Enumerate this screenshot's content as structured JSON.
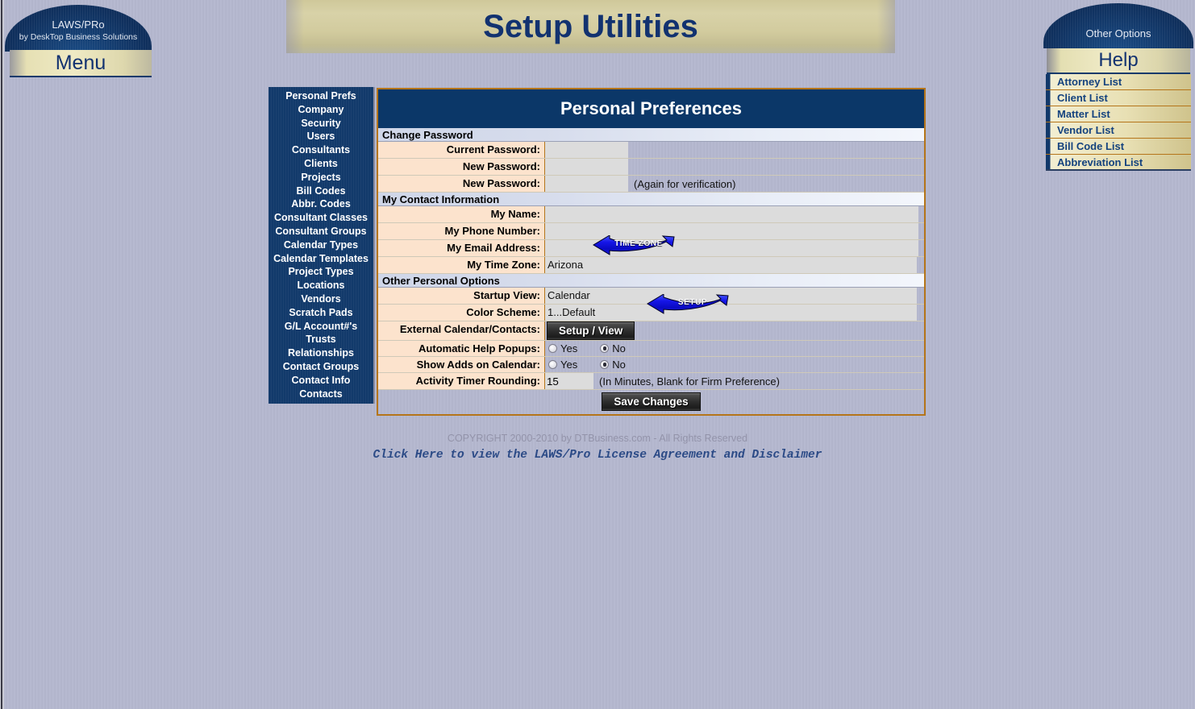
{
  "page": {
    "title": "Setup Utilities"
  },
  "logo": {
    "name": "LAWS/PRo",
    "subtitle": "by DeskTop Business Solutions",
    "menu_label": "Menu"
  },
  "options_panel": {
    "header": "Other Options",
    "help_label": "Help",
    "items": [
      {
        "label": "Attorney List"
      },
      {
        "label": "Client List"
      },
      {
        "label": "Matter List"
      },
      {
        "label": "Vendor List"
      },
      {
        "label": "Bill Code List"
      },
      {
        "label": "Abbreviation List"
      }
    ]
  },
  "setup_menu": {
    "items": [
      {
        "label": "Personal Prefs"
      },
      {
        "label": "Company"
      },
      {
        "label": "Security"
      },
      {
        "label": "Users"
      },
      {
        "label": "Consultants"
      },
      {
        "label": "Clients"
      },
      {
        "label": "Projects"
      },
      {
        "label": "Bill Codes"
      },
      {
        "label": "Abbr. Codes"
      },
      {
        "label": "Consultant Classes"
      },
      {
        "label": "Consultant Groups"
      },
      {
        "label": "Calendar Types"
      },
      {
        "label": "Calendar Templates"
      },
      {
        "label": "Project Types"
      },
      {
        "label": "Locations"
      },
      {
        "label": "Vendors"
      },
      {
        "label": "Scratch Pads"
      },
      {
        "label": "G/L Account#'s"
      },
      {
        "label": "Trusts"
      },
      {
        "label": "Relationships"
      },
      {
        "label": "Contact Groups"
      },
      {
        "label": "Contact Info"
      },
      {
        "label": "Contacts"
      }
    ]
  },
  "form": {
    "header": "Personal Preferences",
    "sections": {
      "change_password": {
        "title": "Change Password",
        "current_password_label": "Current Password:",
        "current_password_value": "",
        "new_password_label": "New Password:",
        "new_password_value": "",
        "new_password_verify_label": "New Password:",
        "new_password_verify_value": "",
        "verify_note": "(Again for verification)"
      },
      "contact_information": {
        "title": "My Contact Information",
        "name_label": "My Name:",
        "name_value": "",
        "phone_label": "My Phone Number:",
        "phone_value": "",
        "email_label": "My Email Address:",
        "email_value": "",
        "timezone_label": "My Time Zone:",
        "timezone_value": "Arizona"
      },
      "other_options": {
        "title": "Other Personal Options",
        "startup_view_label": "Startup View:",
        "startup_view_value": "Calendar",
        "color_scheme_label": "Color Scheme:",
        "color_scheme_value": "1...Default",
        "external_calendar_label": "External Calendar/Contacts:",
        "external_calendar_button": "Setup / View",
        "help_popups_label": "Automatic Help Popups:",
        "help_popups_yes": "Yes",
        "help_popups_no": "No",
        "help_popups_selected": "No",
        "show_adds_label": "Show Adds on Calendar:",
        "show_adds_yes": "Yes",
        "show_adds_no": "No",
        "show_adds_selected": "No",
        "timer_rounding_label": "Activity Timer Rounding:",
        "timer_rounding_value": "15",
        "timer_rounding_note": "(In Minutes, Blank for Firm Preference)",
        "save_button": "Save Changes"
      }
    }
  },
  "callouts": {
    "timezone": "TIME ZONE",
    "setup": "SETUP"
  },
  "footer": {
    "copyright": "COPYRIGHT 2000-2010 by DTBusiness.com - All Rights Reserved",
    "license_link": "Click Here to view the LAWS/Pro License Agreement and Disclaimer"
  },
  "colors": {
    "navy": "#123a6b",
    "header_navy": "#0b3768",
    "gold_border": "#b5751a",
    "label_peach": "#fce3cd",
    "input_gray": "#dcdcdc",
    "page_bg": "#b4b7cd",
    "link_blue": "#2b4a86"
  }
}
